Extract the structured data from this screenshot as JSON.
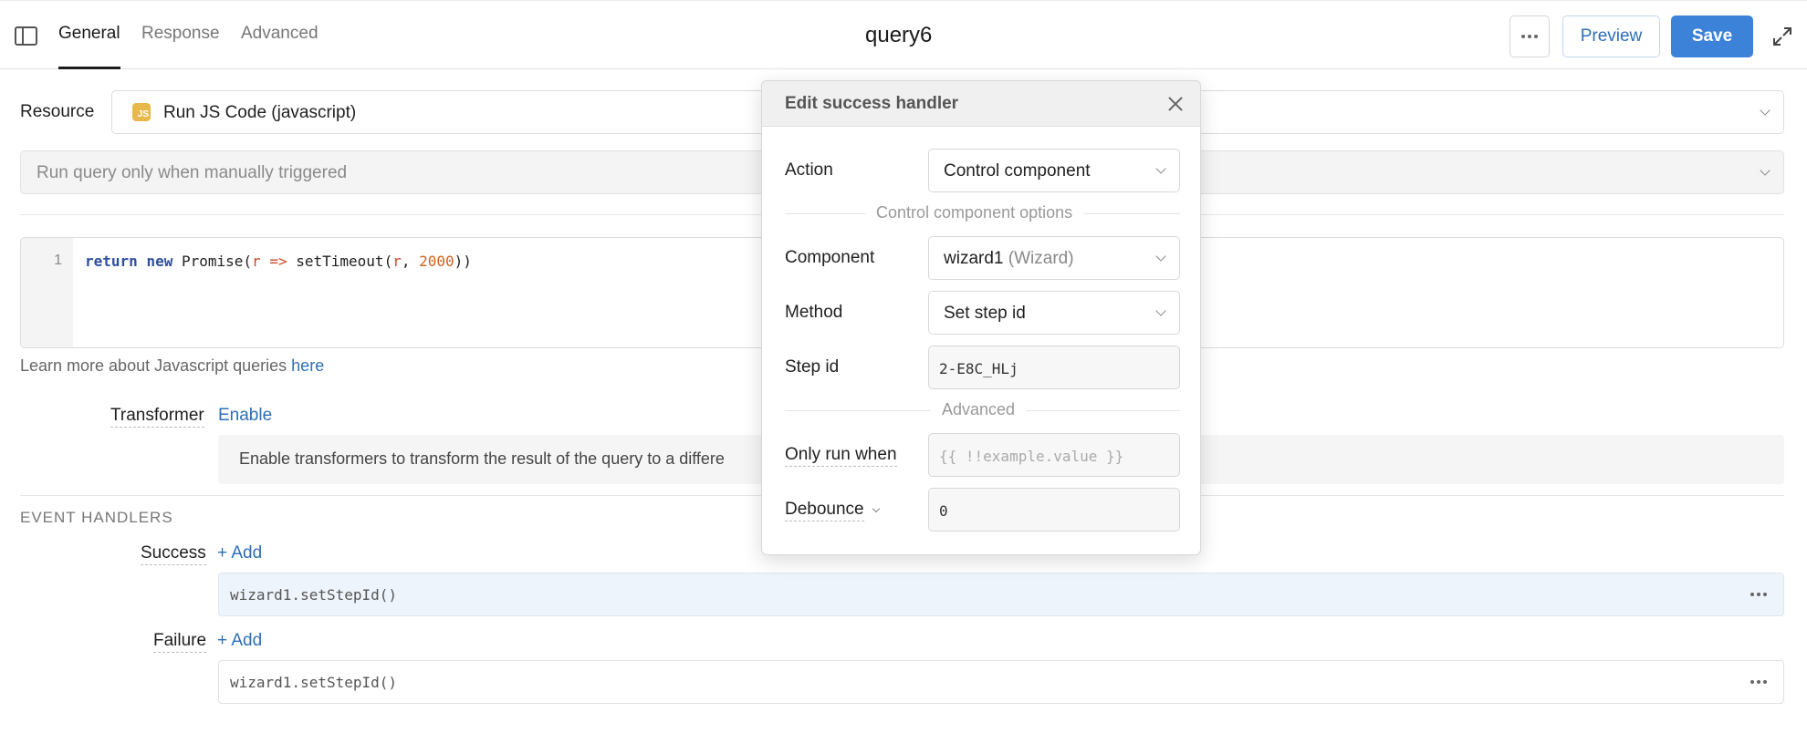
{
  "header": {
    "tabs": [
      {
        "label": "General",
        "active": true
      },
      {
        "label": "Response",
        "active": false
      },
      {
        "label": "Advanced",
        "active": false
      }
    ],
    "query_name": "query6",
    "preview_label": "Preview",
    "save_label": "Save",
    "accent_color": "#3c82d9"
  },
  "resource": {
    "label": "Resource",
    "badge": "JS",
    "value": "Run JS Code (javascript)"
  },
  "trigger": {
    "value": "Run query only when manually triggered"
  },
  "editor": {
    "line_number": "1",
    "code": {
      "kw1": "return",
      "kw2": "new",
      "p1": "Promise(",
      "param1": "r",
      "arrow": "=>",
      "p2": "setTimeout(",
      "param2": "r",
      "p3": ", ",
      "num": "2000",
      "p4": "))"
    }
  },
  "learn_more": {
    "text": "Learn more about Javascript queries ",
    "link": "here"
  },
  "transformer": {
    "label": "Transformer",
    "action": "Enable",
    "info": "Enable transformers to transform the result of the query to a differe"
  },
  "event_handlers": {
    "title": "EVENT HANDLERS",
    "success": {
      "label": "Success",
      "add": "+ Add",
      "handler": "wizard1.setStepId()"
    },
    "failure": {
      "label": "Failure",
      "add": "+ Add",
      "handler": "wizard1.setStepId()"
    }
  },
  "modal": {
    "title": "Edit success handler",
    "action_label": "Action",
    "action_value": "Control component",
    "options_label": "Control component options",
    "component_label": "Component",
    "component_value": "wizard1",
    "component_type": "(Wizard)",
    "method_label": "Method",
    "method_value": "Set step id",
    "step_label": "Step id",
    "step_value": "2-E8C_HLj",
    "advanced_label": "Advanced",
    "only_run_label": "Only run when",
    "only_run_placeholder": "{{ !!example.value }}",
    "debounce_label": "Debounce",
    "debounce_value": "0"
  }
}
